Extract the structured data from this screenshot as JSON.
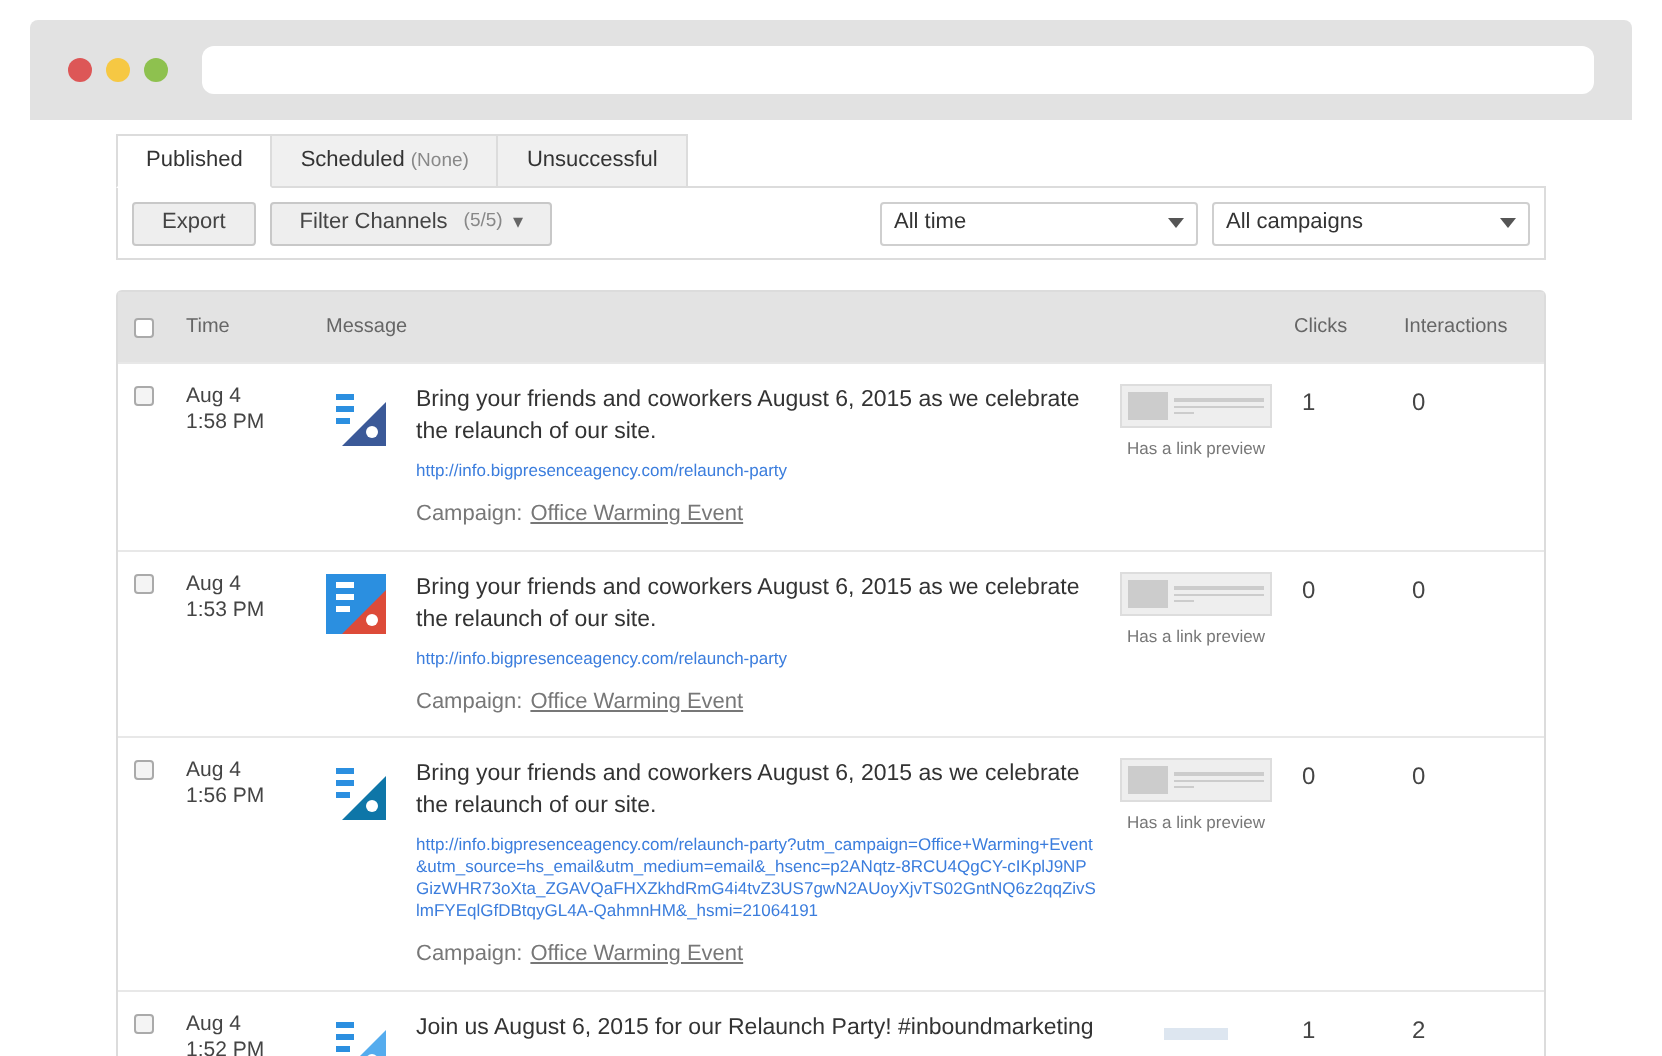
{
  "tabs": [
    {
      "label": "Published",
      "selected": true
    },
    {
      "label": "Scheduled",
      "note": "(None)",
      "selected": false
    },
    {
      "label": "Unsuccessful",
      "selected": false
    }
  ],
  "toolbar": {
    "export": "Export",
    "filter": {
      "label": "Filter Channels",
      "count": "(5/5)",
      "caret": "▾"
    },
    "time_select": "All time",
    "campaign_select": "All campaigns"
  },
  "table": {
    "select_all_checked": false,
    "columns": [
      "Time",
      "Message",
      "Clicks",
      "Interactions"
    ],
    "rows": [
      {
        "checked": false,
        "date": "Aug 4",
        "time": "1:58 PM",
        "kind": "facebook",
        "message": "Bring your friends and coworkers August 6, 2015 as we celebrate the relaunch of our site.",
        "link": "http://info.bigpresenceagency.com/relaunch-party",
        "campaign_label": "Campaign:",
        "campaign": "Office Warming Event",
        "preview_label": "Has a link preview",
        "clicks": "1",
        "interactions": "0"
      },
      {
        "checked": false,
        "date": "Aug 4",
        "time": "1:53 PM",
        "kind": "googleplus",
        "message": "Bring your friends and coworkers August 6, 2015 as we celebrate the relaunch of our site.",
        "link": "http://info.bigpresenceagency.com/relaunch-party",
        "campaign_label": "Campaign:",
        "campaign": "Office Warming Event",
        "preview_label": "Has a link preview",
        "clicks": "0",
        "interactions": "0"
      },
      {
        "checked": false,
        "date": "Aug 4",
        "time": "1:56 PM",
        "kind": "linkedin",
        "message": "Bring your friends and coworkers August 6, 2015 as we celebrate the relaunch of our site.",
        "link": "http://info.bigpresenceagency.com/relaunch-party?utm_campaign=Office+Warming+Event&utm_source=hs_email&utm_medium=email&_hsenc=p2ANqtz-8RCU4QgCY-cIKplJ9NPGizWHR73oXta_ZGAVQaFHXZkhdRmG4i4tvZ3US7gwN2AUoyXjvTS02GntNQ6z2qqZivSlmFYEqlGfDBtqyGL4A-QahmnHM&_hsmi=21064191",
        "campaign_label": "Campaign:",
        "campaign": "Office Warming Event",
        "preview_label": "Has a link preview",
        "clicks": "0",
        "interactions": "0"
      },
      {
        "checked": false,
        "date": "Aug 4",
        "time": "1:52 PM",
        "kind": "twitter",
        "message": "Join us August 6, 2015 for our Relaunch Party! #inboundmarketing",
        "clicks": "1",
        "interactions": "2"
      }
    ]
  }
}
